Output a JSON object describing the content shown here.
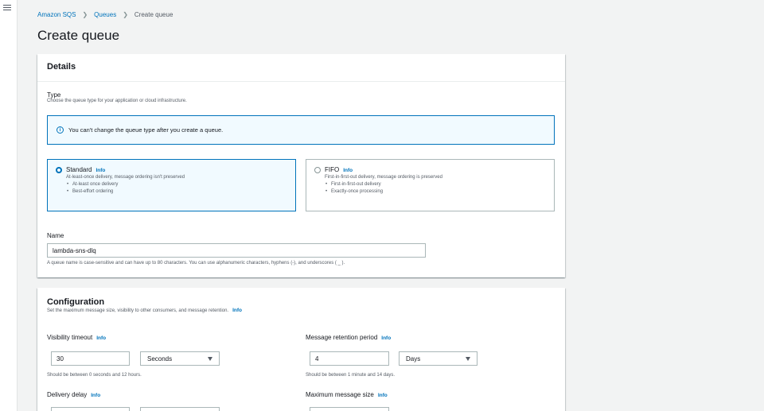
{
  "breadcrumb": {
    "items": [
      "Amazon SQS",
      "Queues"
    ],
    "current": "Create queue"
  },
  "page": {
    "title": "Create queue"
  },
  "details": {
    "header": "Details",
    "type_label": "Type",
    "type_desc": "Choose the queue type for your application or cloud infrastructure.",
    "alert": "You can't change the queue type after you create a queue.",
    "standard": {
      "title": "Standard",
      "info": "Info",
      "desc": "At-least-once delivery, message ordering isn't preserved",
      "bullets": [
        "At-least once delivery",
        "Best-effort ordering"
      ],
      "selected": true
    },
    "fifo": {
      "title": "FIFO",
      "info": "Info",
      "desc": "First-in-first-out delivery, message ordering is preserved",
      "bullets": [
        "First-in-first-out delivery",
        "Exactly-once processing"
      ],
      "selected": false
    },
    "name_label": "Name",
    "name_value": "lambda-sns-dlq",
    "name_hint": "A queue name is case-sensitive and can have up to 80 characters. You can use alphanumeric characters, hyphens (-), and underscores ( _ )."
  },
  "config": {
    "header": "Configuration",
    "desc": "Set the maximum message size, visibility to other consumers, and message retention.",
    "info": "Info",
    "visibility": {
      "label": "Visibility timeout",
      "info": "Info",
      "value": "30",
      "unit": "Seconds",
      "hint": "Should be between 0 seconds and 12 hours."
    },
    "retention": {
      "label": "Message retention period",
      "info": "Info",
      "value": "4",
      "unit": "Days",
      "hint": "Should be between 1 minute and 14 days."
    },
    "delay": {
      "label": "Delivery delay",
      "info": "Info"
    },
    "max_size": {
      "label": "Maximum message size",
      "info": "Info"
    }
  },
  "colors": {
    "link": "#0073bb",
    "background": "#f2f3f3",
    "text": "#16191f",
    "muted": "#545b64"
  }
}
